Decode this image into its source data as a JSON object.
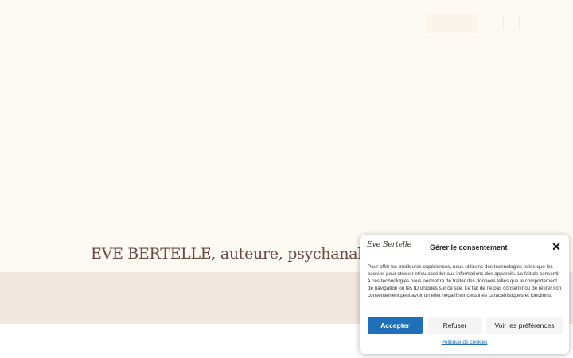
{
  "hero": {
    "title": "EVE BERTELLE, auteure, psychanalyste et p"
  },
  "header": {
    "icons": [
      "menu-icon",
      "bag-icon"
    ]
  },
  "consent": {
    "logo_text": "Eve Bertelle",
    "title": "Gérer le consentement",
    "close_label": "✕",
    "body": "Pour offrir les meilleures expériences, nous utilisons des technologies telles que les cookies pour stocker et/ou accéder aux informations des appareils. Le fait de consentir à ces technologies nous permettra de traiter des données telles que le comportement de navigation ou les ID uniques sur ce site. Le fait de ne pas consentir ou de retirer son consentement peut avoir un effet négatif sur certaines caractéristiques et fonctions.",
    "accept_label": "Accepter",
    "refuse_label": "Refuser",
    "preferences_label": "Voir les préférences",
    "policy_label": "Politique de cookies",
    "accent_color": "#1f70b8"
  }
}
